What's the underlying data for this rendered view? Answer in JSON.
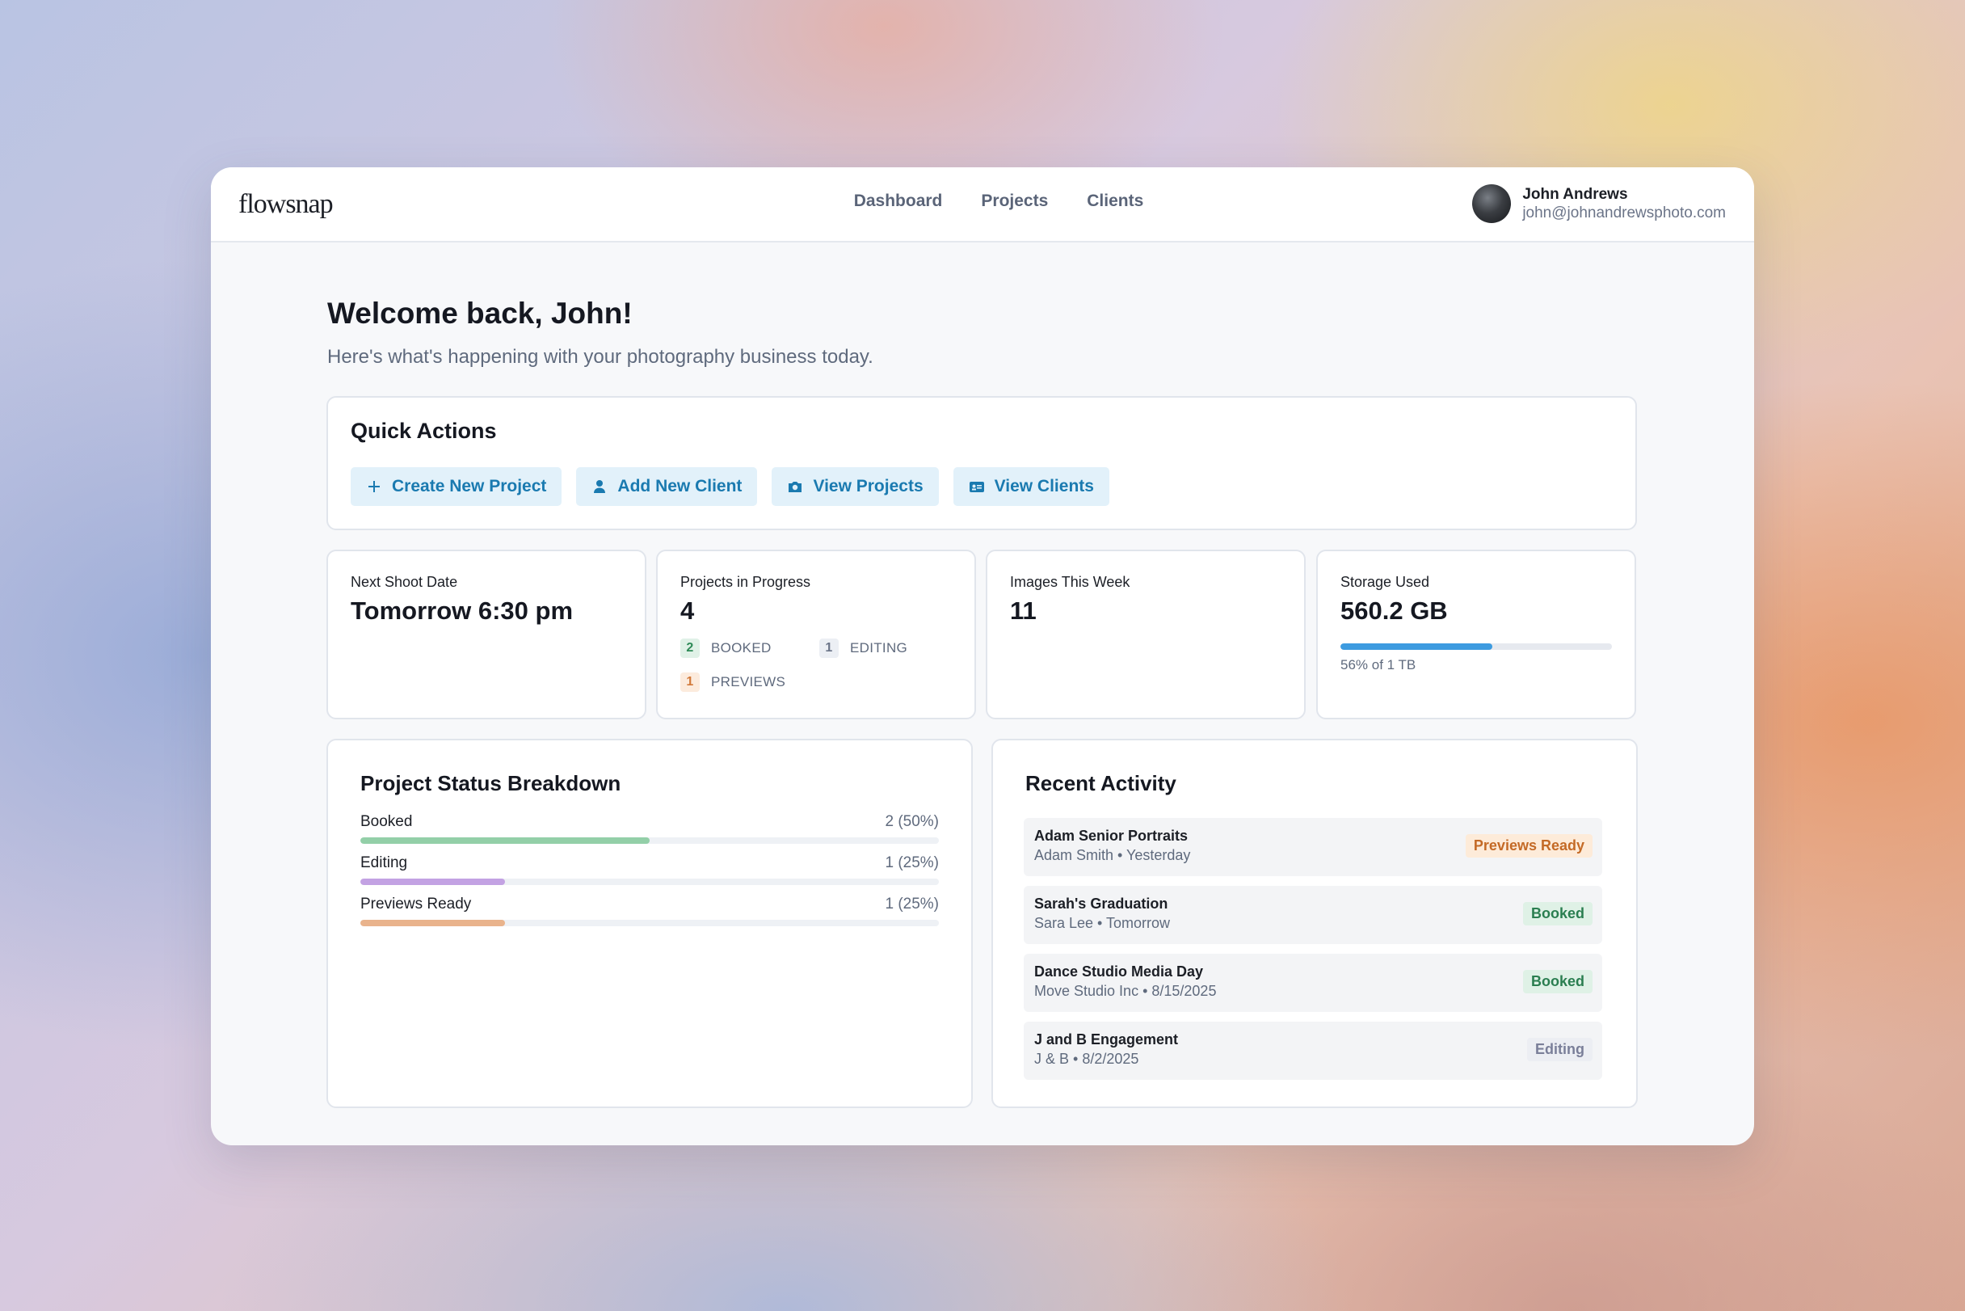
{
  "header": {
    "logo": "flowsnap",
    "nav": [
      "Dashboard",
      "Projects",
      "Clients"
    ],
    "user_name": "John Andrews",
    "user_email": "john@johnandrewsphoto.com"
  },
  "welcome": {
    "title": "Welcome back, John!",
    "subtitle": "Here's what's happening with your photography business today."
  },
  "quick_actions": {
    "title": "Quick Actions",
    "buttons": [
      {
        "label": "Create New Project",
        "icon": "plus-icon"
      },
      {
        "label": "Add New Client",
        "icon": "user-icon"
      },
      {
        "label": "View Projects",
        "icon": "camera-icon"
      },
      {
        "label": "View Clients",
        "icon": "id-card-icon"
      }
    ]
  },
  "stats": {
    "next_shoot": {
      "label": "Next Shoot Date",
      "value": "Tomorrow 6:30 pm"
    },
    "in_progress": {
      "label": "Projects in Progress",
      "value": "4",
      "booked_count": "2",
      "booked_label": "BOOKED",
      "editing_count": "1",
      "editing_label": "EDITING",
      "previews_count": "1",
      "previews_label": "PREVIEWS"
    },
    "images": {
      "label": "Images This Week",
      "value": "11"
    },
    "storage": {
      "label": "Storage Used",
      "value": "560.2 GB",
      "caption": "56% of 1 TB",
      "fraction": 0.56
    }
  },
  "breakdown": {
    "title": "Project Status Breakdown",
    "rows": [
      {
        "name": "Booked",
        "count": "2 (50%)",
        "fraction": 0.5,
        "color": "#93cfa8"
      },
      {
        "name": "Editing",
        "count": "1 (25%)",
        "fraction": 0.25,
        "color": "#c3a2e3"
      },
      {
        "name": "Previews Ready",
        "count": "1 (25%)",
        "fraction": 0.25,
        "color": "#e9b38c"
      }
    ]
  },
  "activity": {
    "title": "Recent Activity",
    "items": [
      {
        "title": "Adam Senior Portraits",
        "sub": "Adam Smith • Yesterday",
        "status": "Previews Ready"
      },
      {
        "title": "Sarah's Graduation",
        "sub": "Sara Lee • Tomorrow",
        "status": "Booked"
      },
      {
        "title": "Dance Studio Media Day",
        "sub": "Move Studio Inc • 8/15/2025",
        "status": "Booked"
      },
      {
        "title": "J and B Engagement",
        "sub": "J & B • 8/2/2025",
        "status": "Editing"
      }
    ]
  }
}
